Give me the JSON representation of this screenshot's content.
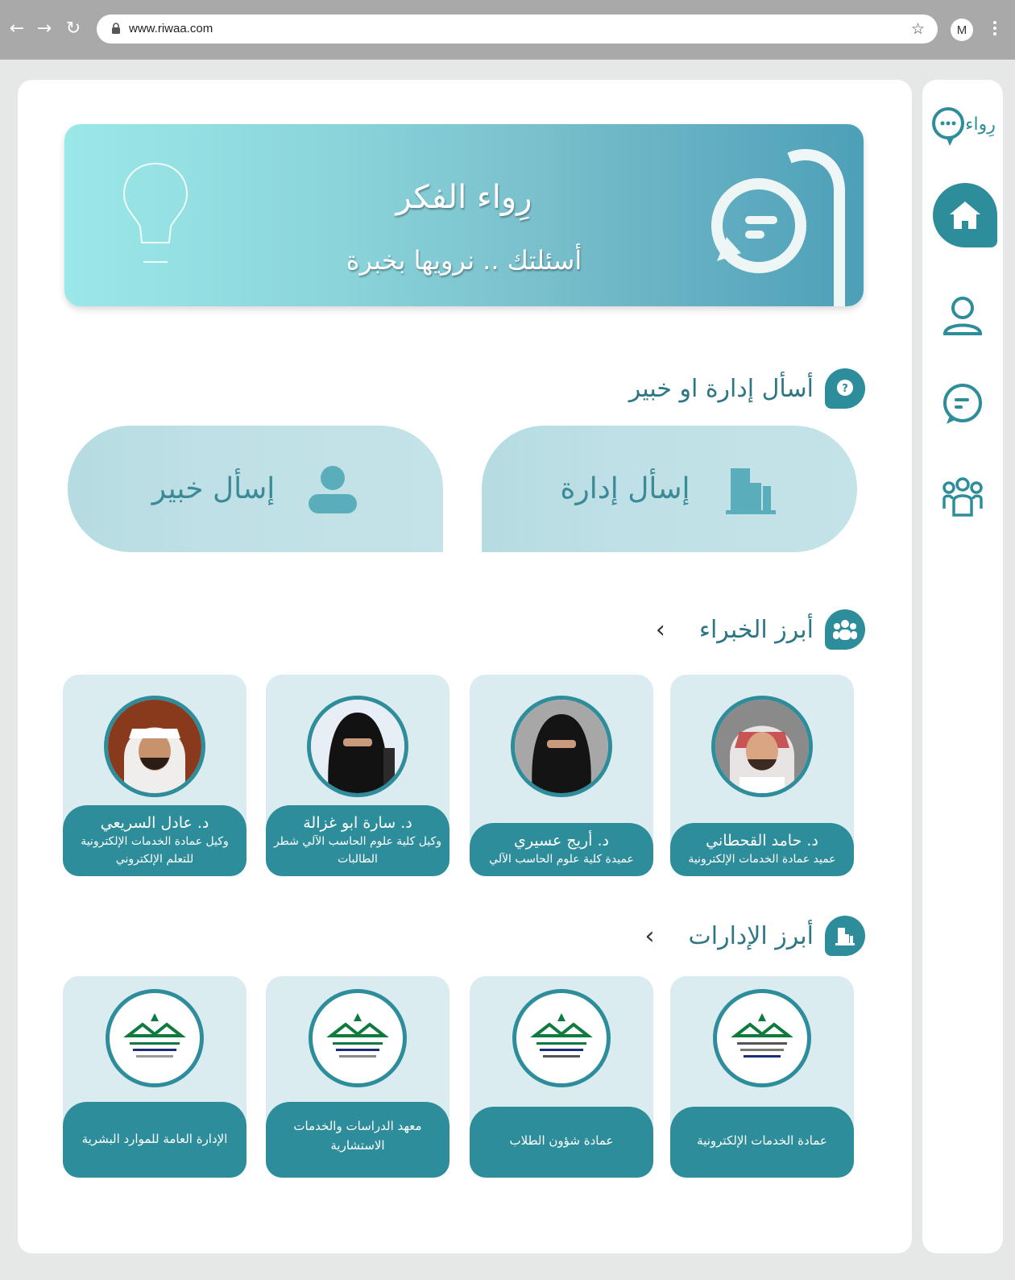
{
  "browser": {
    "url": "www.riwaa.com",
    "profile_initial": "M"
  },
  "banner": {
    "title": "رِواء الفكر",
    "subtitle": "أسئلتك .. نرويها بخبرة"
  },
  "ask_section": {
    "title": "أسأل إدارة او خبير",
    "ask_management": "إسأل إدارة",
    "ask_expert": "إسأل خبير"
  },
  "experts_section": {
    "title": "أبرز الخبراء",
    "experts": [
      {
        "name": "د. حامد القحطاني",
        "role": "عميد عمادة الخدمات الإلكترونية"
      },
      {
        "name": "د. أريج عسيري",
        "role": "عميدة كلية علوم الحاسب الآلي"
      },
      {
        "name": "د. سارة ابو غزالة",
        "role": "وكيل كلية علوم الحاسب الآلي شطر الطالبات"
      },
      {
        "name": "د. عادل السريعي",
        "role": "وكيل عمادة الخدمات الإلكترونية للتعلم الإلكتروني"
      }
    ]
  },
  "departments_section": {
    "title": "أبرز الإدارات",
    "departments": [
      {
        "name": "عمادة الخدمات الإلكترونية"
      },
      {
        "name": "عمادة شؤون الطلاب"
      },
      {
        "name": "معهد الدراسات والخدمات الاستشارية"
      },
      {
        "name": "الإدارة العامة للموارد البشرية"
      }
    ]
  },
  "sidebar": {
    "logo_text": "رِواء"
  },
  "colors": {
    "primary": "#2e8d9b",
    "card_bg": "#daecef",
    "banner_start": "#9be8e8",
    "banner_end": "#4d9fb8"
  }
}
